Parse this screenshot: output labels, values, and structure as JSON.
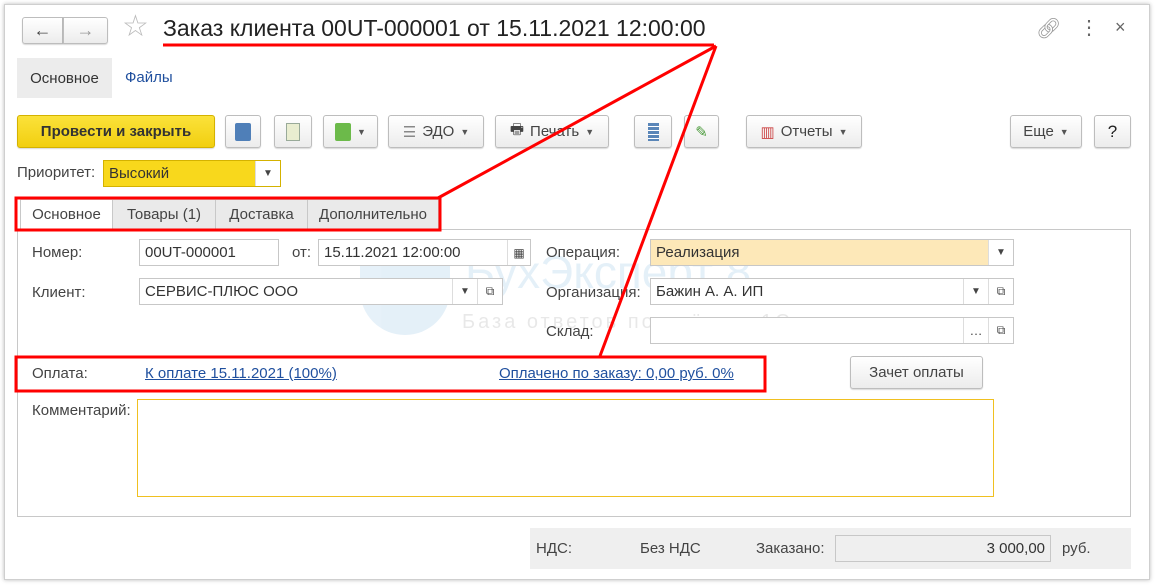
{
  "window": {
    "title": "Заказ клиента 00UT-000001 от 15.11.2021 12:00:00"
  },
  "nav": {
    "back": "←",
    "forward": "→"
  },
  "sections": [
    {
      "label": "Основное"
    },
    {
      "label": "Файлы"
    }
  ],
  "toolbar": {
    "post_close": "Провести и закрыть",
    "edo": "ЭДО",
    "print": "Печать",
    "reports": "Отчеты",
    "more": "Еще",
    "help": "?"
  },
  "priority": {
    "label": "Приоритет:",
    "value": "Высокий"
  },
  "tabs": [
    {
      "label": "Основное"
    },
    {
      "label": "Товары (1)"
    },
    {
      "label": "Доставка"
    },
    {
      "label": "Дополнительно"
    }
  ],
  "form": {
    "number_label": "Номер:",
    "number": "00UT-000001",
    "date_label": "от:",
    "date": "15.11.2021 12:00:00",
    "operation_label": "Операция:",
    "operation": "Реализация",
    "client_label": "Клиент:",
    "client": "СЕРВИС-ПЛЮС ООО",
    "org_label": "Организация:",
    "org": "Бажин А. А. ИП",
    "warehouse_label": "Склад:",
    "warehouse": "",
    "payment_label": "Оплата:",
    "payment_link": "К оплате 15.11.2021 (100%)",
    "paid_link": "Оплачено по заказу: 0,00 руб. 0%",
    "offset_button": "Зачет оплаты",
    "comment_label": "Комментарий:",
    "comment": ""
  },
  "footer": {
    "vat_label": "НДС:",
    "vat_value": "Без НДС",
    "ordered_label": "Заказано:",
    "ordered_value": "3 000,00",
    "currency": "руб."
  },
  "watermark": {
    "brand": "БухЭксперт 8",
    "tagline": "База ответов по учёту в 1С"
  },
  "colors": {
    "accent_yellow": "#f8d81c",
    "annotation": "#ff0000",
    "operation_bg": "#fde8b8"
  }
}
